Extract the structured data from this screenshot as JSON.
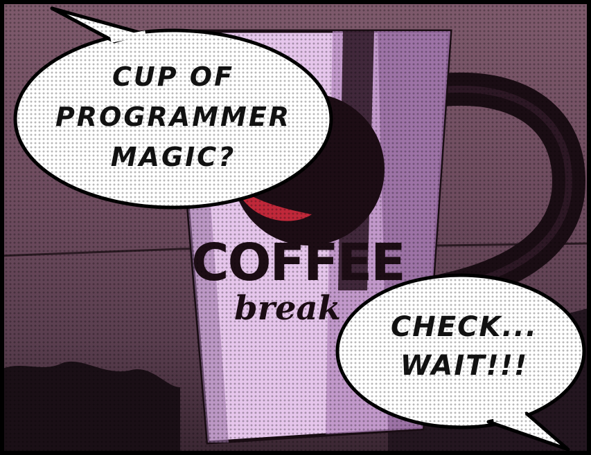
{
  "speech_bubbles": {
    "top_left": {
      "lines": [
        "CUP OF",
        "PROGRAMMER",
        "MAGIC?"
      ]
    },
    "bottom_right": {
      "lines": [
        "CHECK...",
        "WAIT!!!"
      ]
    }
  },
  "mug_print": {
    "word": "COFFEE",
    "script": "break"
  },
  "colors": {
    "background": "#6d4b5e",
    "mug": "#e6c6ec",
    "bubble": "#ffffff",
    "outline": "#000000",
    "accent_red": "#c0283a"
  }
}
